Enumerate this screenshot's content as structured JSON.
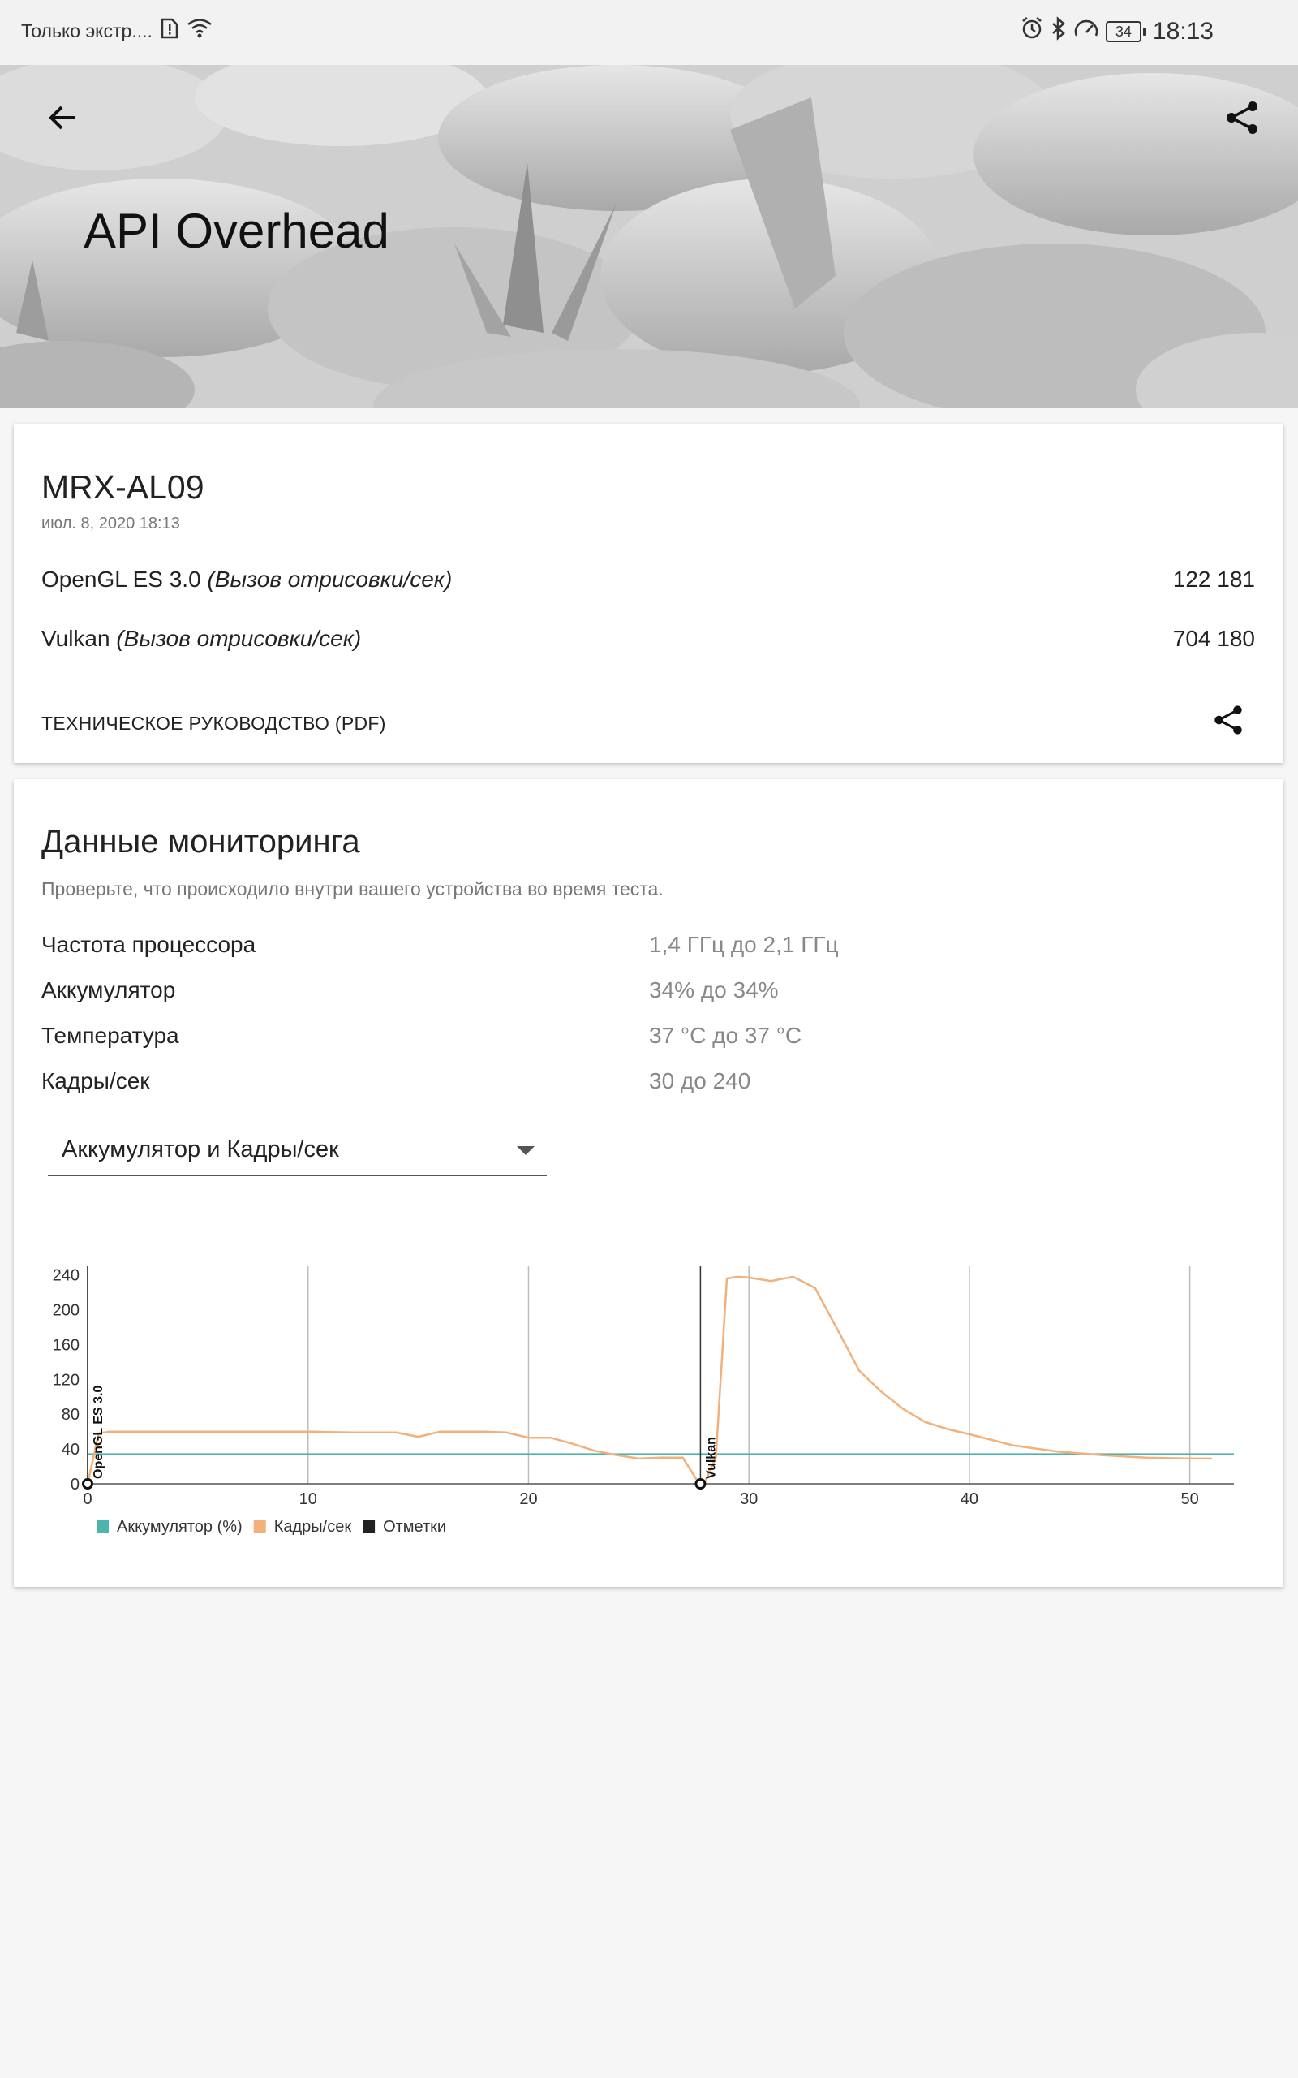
{
  "status_bar": {
    "carrier": "Только экстр....",
    "battery": "34",
    "time": "18:13"
  },
  "header": {
    "title": "API Overhead"
  },
  "result_card": {
    "device": "MRX-AL09",
    "date": "июл. 8, 2020 18:13",
    "rows": [
      {
        "name": "OpenGL ES 3.0",
        "unit": "(Вызов отрисовки/сек)",
        "value": "122 181"
      },
      {
        "name": "Vulkan",
        "unit": "(Вызов отрисовки/сек)",
        "value": "704 180"
      }
    ],
    "pdf_link": "ТЕХНИЧЕСКОЕ РУКОВОДСТВО (PDF)"
  },
  "monitoring": {
    "title": "Данные мониторинга",
    "subtitle": "Проверьте, что происходило внутри вашего устройства во время теста.",
    "rows": [
      {
        "label": "Частота процессора",
        "value": "1,4 ГГц до 2,1 ГГц"
      },
      {
        "label": "Аккумулятор",
        "value": "34% до 34%"
      },
      {
        "label": "Температура",
        "value": "37 °C до 37 °C"
      },
      {
        "label": "Кадры/сек",
        "value": "30 до 240"
      }
    ],
    "dropdown_selected": "Аккумулятор и Кадры/сек"
  },
  "chart_data": {
    "type": "line",
    "xlim": [
      0,
      52
    ],
    "ylim": [
      0,
      250
    ],
    "x_ticks": [
      0,
      10,
      20,
      30,
      40,
      50
    ],
    "y_ticks": [
      0,
      40,
      80,
      120,
      160,
      200,
      240
    ],
    "grid": true,
    "legend_position": "bottom-left",
    "series": [
      {
        "name": "Аккумулятор (%)",
        "color": "#4db6ac",
        "x": [
          0,
          52
        ],
        "y": [
          34,
          34
        ]
      },
      {
        "name": "Кадры/сек",
        "color": "#f4b07a",
        "x": [
          0,
          0.5,
          1,
          2,
          4,
          6,
          8,
          10,
          12,
          14,
          15,
          16,
          17,
          18,
          19,
          20,
          21,
          22,
          23,
          24,
          25,
          26,
          27,
          27.7,
          28,
          28.5,
          29,
          29.5,
          30,
          31,
          32,
          33,
          34,
          35,
          36,
          37,
          38,
          39,
          40,
          42,
          44,
          46,
          48,
          50,
          51
        ],
        "y": [
          0,
          58,
          60,
          60,
          60,
          60,
          60,
          60,
          59,
          59,
          54,
          60,
          60,
          60,
          59,
          53,
          53,
          46,
          38,
          33,
          29,
          30,
          30,
          2,
          2,
          30,
          236,
          238,
          237,
          233,
          238,
          225,
          178,
          130,
          106,
          86,
          71,
          63,
          57,
          44,
          37,
          33,
          30,
          29,
          29
        ]
      }
    ],
    "markers": [
      {
        "label": "OpenGL ES 3.0",
        "x": 0
      },
      {
        "label": "Vulkan",
        "x": 27.8
      }
    ],
    "legend": [
      {
        "label": "Аккумулятор (%)",
        "color": "#4db6ac"
      },
      {
        "label": "Кадры/сек",
        "color": "#f4b07a"
      },
      {
        "label": "Отметки",
        "color": "#222222"
      }
    ]
  }
}
